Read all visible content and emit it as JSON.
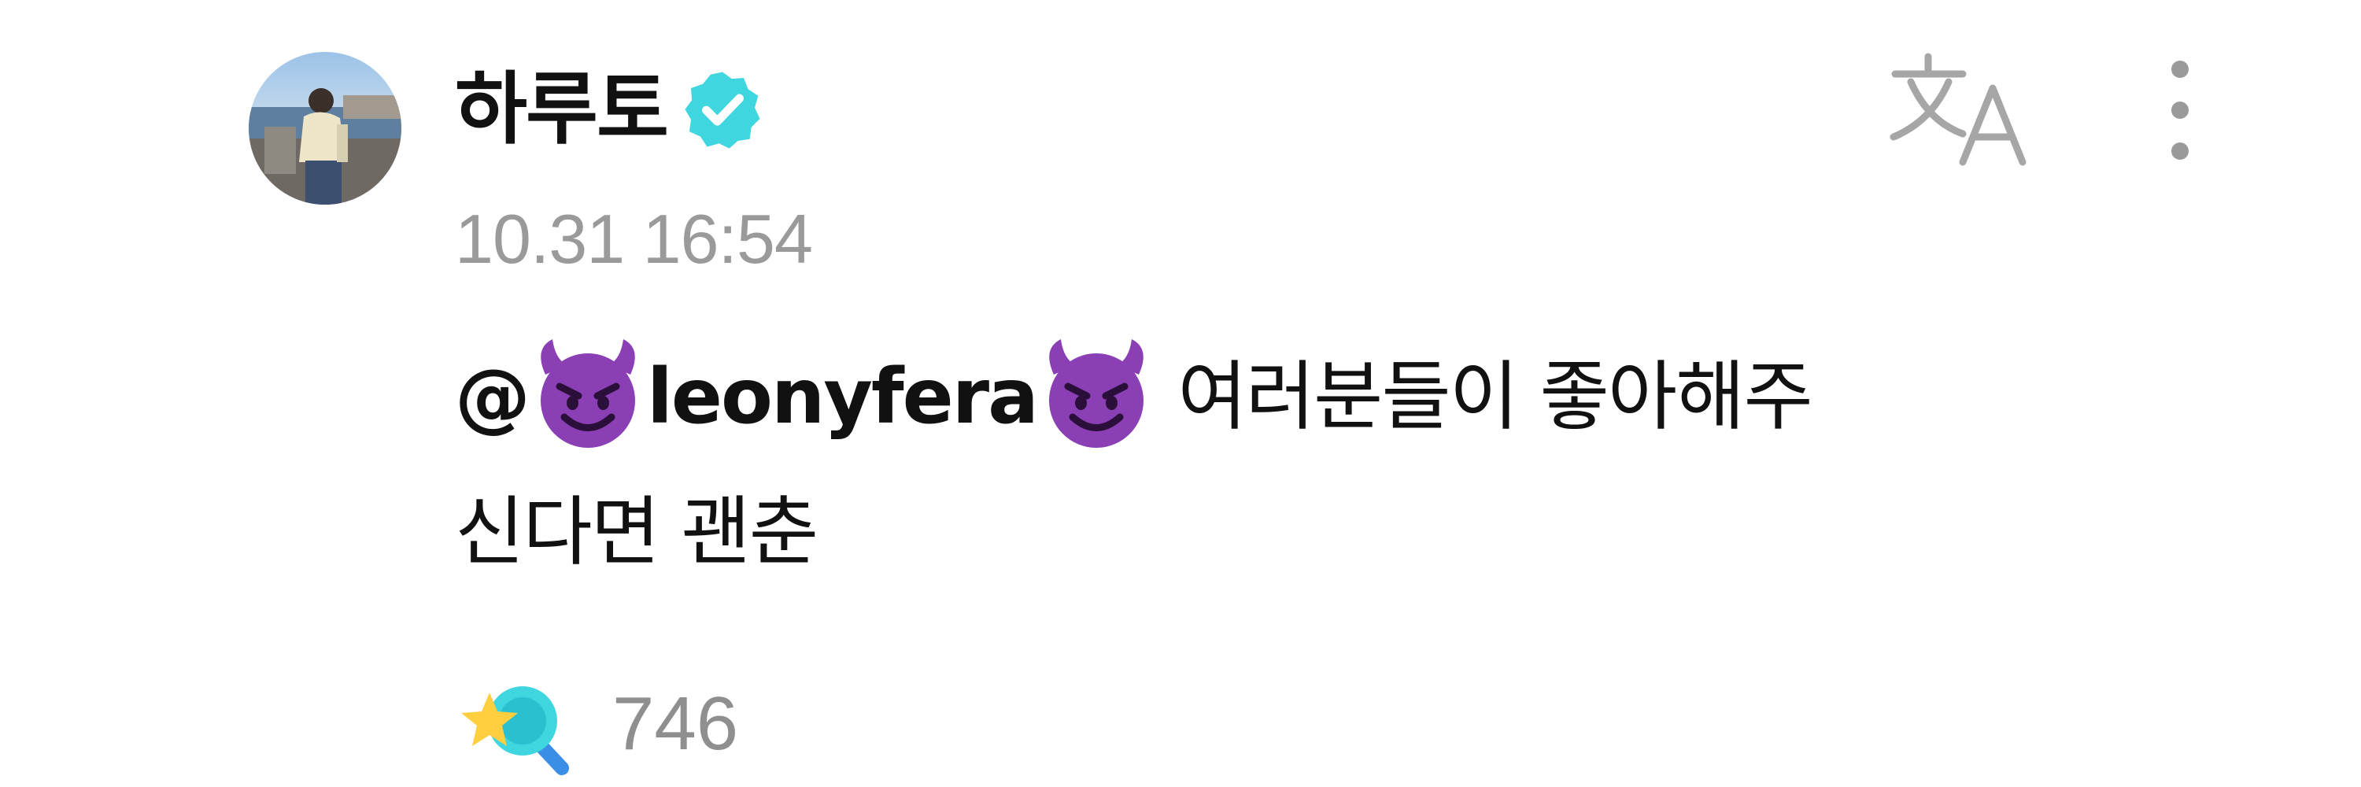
{
  "post": {
    "author": {
      "name": "하루토",
      "verified": true,
      "verified_color": "#3fd6e0"
    },
    "timestamp": "10.31 16:54",
    "body": {
      "mention": "@😈leonyfera😈",
      "mention_prefix": "@",
      "mention_handle": "leonyfera",
      "mention_emoji": "smiling-face-with-horns",
      "line1_text": " 여러분들이 좋아해주",
      "line2_text": "신다면 괜춘"
    },
    "reaction": {
      "icon": "star-magnifier-reaction",
      "count": "746"
    },
    "actions": {
      "translate_icon": "translate-icon",
      "more_icon": "more-vertical-icon"
    }
  },
  "colors": {
    "text": "#111111",
    "muted": "#9a9a9a",
    "emoji_purple": "#8a3fb4",
    "accent_cyan": "#3fd6e0"
  }
}
